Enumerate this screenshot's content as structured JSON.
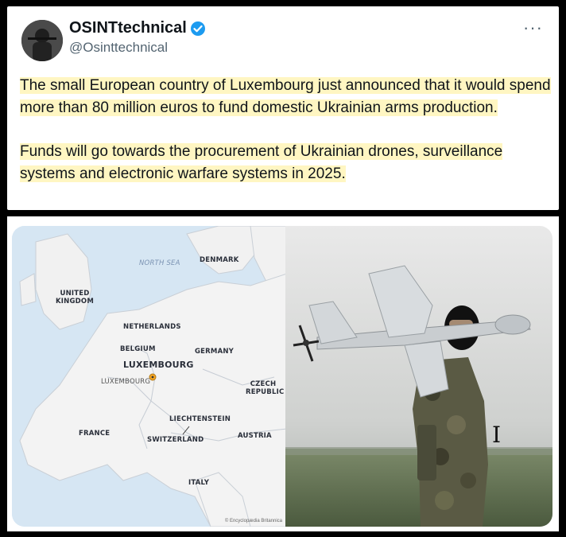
{
  "tweet": {
    "display_name": "OSINTtechnical",
    "handle": "@Osinttechnical",
    "more_label": "···",
    "paragraph1": "The small European country of Luxembourg just announced that it would spend more than 80 million euros to fund domestic Ukrainian arms production.",
    "paragraph2": "Funds will go towards the procurement of Ukrainian drones, surveillance systems and electronic warfare systems in 2025.",
    "highlight_color": "#fff6c2",
    "verified_color": "#1d9bf0"
  },
  "map": {
    "labels": {
      "north_sea": "NORTH SEA",
      "denmark": "DENMARK",
      "united_kingdom": "UNITED KINGDOM",
      "netherlands": "NETHERLANDS",
      "belgium": "BELGIUM",
      "germany": "GERMANY",
      "luxembourg_country": "LUXEMBOURG",
      "luxembourg_city": "LUXEMBOURG",
      "czech_republic": "CZECH REPUBLIC",
      "liechtenstein": "LIECHTENSTEIN",
      "france": "FRANCE",
      "switzerland": "SWITZERLAND",
      "austria": "AUSTRIA",
      "italy": "ITALY"
    },
    "credit": "© Encyclopædia Britannica"
  },
  "icons": {
    "cursor": "text-cursor-icon",
    "verified": "verified-badge-icon"
  }
}
